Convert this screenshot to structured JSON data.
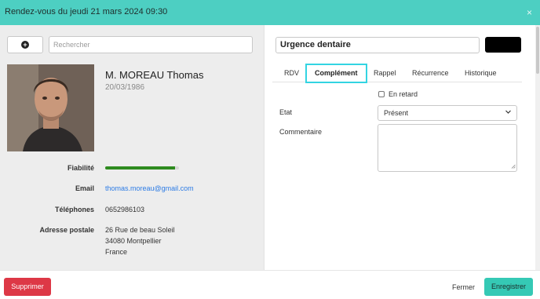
{
  "header": {
    "title": "Rendez-vous du jeudi 21 mars 2024 09:30",
    "close_icon": "×"
  },
  "search": {
    "placeholder": "Rechercher",
    "add_icon": "+"
  },
  "patient": {
    "name": "M. MOREAU Thomas",
    "dob": "20/03/1986",
    "reliability_label": "Fiabilité",
    "reliability_fraction": 0.95,
    "email_label": "Email",
    "email": "thomas.moreau@gmail.com",
    "phones_label": "Téléphones",
    "phone": "0652986103",
    "address_label": "Adresse postale",
    "address_line1": "26 Rue de beau Soleil",
    "address_line2": "34080 Montpellier",
    "address_line3": "France"
  },
  "appointment": {
    "subject": "Urgence dentaire",
    "tabs": [
      {
        "label": "RDV"
      },
      {
        "label": "Complément"
      },
      {
        "label": "Rappel"
      },
      {
        "label": "Récurrence"
      },
      {
        "label": "Historique"
      }
    ],
    "late_label": "En retard",
    "state_label": "Etat",
    "state_value": "Présent",
    "comment_label": "Commentaire"
  },
  "footer": {
    "delete": "Supprimer",
    "close": "Fermer",
    "save": "Enregistrer"
  },
  "colors": {
    "header": "#4dcfc2",
    "accent_tab": "#33d4e2",
    "danger": "#dd3846",
    "success": "#35c9b5",
    "reliability": "#2e8b1f"
  },
  "icons": {
    "close": "close-icon",
    "add": "plus-circle-icon",
    "chevron": "chevron-down-icon",
    "resize": "resize-grip-icon"
  }
}
